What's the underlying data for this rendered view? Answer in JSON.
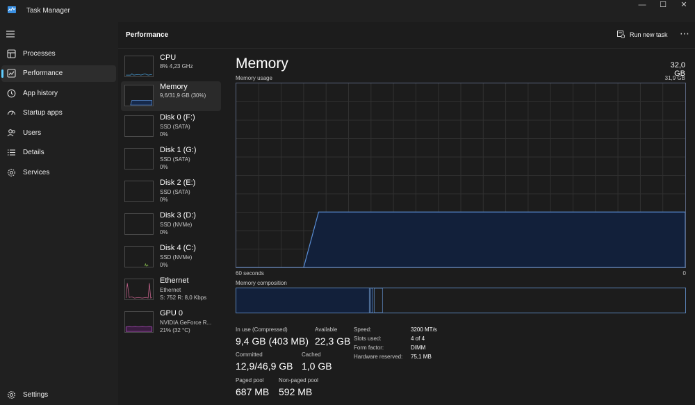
{
  "window": {
    "title": "Task Manager"
  },
  "sidebar": {
    "items": [
      {
        "label": "Processes"
      },
      {
        "label": "Performance"
      },
      {
        "label": "App history"
      },
      {
        "label": "Startup apps"
      },
      {
        "label": "Users"
      },
      {
        "label": "Details"
      },
      {
        "label": "Services"
      }
    ],
    "settings": "Settings"
  },
  "header": {
    "title": "Performance",
    "run_new_task": "Run new task"
  },
  "devices": [
    {
      "name": "CPU",
      "line1": "8% 4,23 GHz"
    },
    {
      "name": "Memory",
      "line1": "9,6/31,9 GB (30%)"
    },
    {
      "name": "Disk 0 (F:)",
      "line1": "SSD (SATA)",
      "line2": "0%"
    },
    {
      "name": "Disk 1 (G:)",
      "line1": "SSD (SATA)",
      "line2": "0%"
    },
    {
      "name": "Disk 2 (E:)",
      "line1": "SSD (SATA)",
      "line2": "0%"
    },
    {
      "name": "Disk 3 (D:)",
      "line1": "SSD (NVMe)",
      "line2": "0%"
    },
    {
      "name": "Disk 4 (C:)",
      "line1": "SSD (NVMe)",
      "line2": "0%"
    },
    {
      "name": "Ethernet",
      "line1": "Ethernet",
      "line2": "S: 752 R: 8,0 Kbps"
    },
    {
      "name": "GPU 0",
      "line1": "NVIDIA GeForce R...",
      "line2": "21% (32 °C)"
    }
  ],
  "memory": {
    "title": "Memory",
    "total": "32,0 GB",
    "usage_label": "Memory usage",
    "usage_max": "31,9 GB",
    "time_label": "60 seconds",
    "time_end": "0",
    "composition_label": "Memory composition",
    "stats": {
      "in_use_label": "In use (Compressed)",
      "in_use": "9,4 GB (403 MB)",
      "available_label": "Available",
      "available": "22,3 GB",
      "committed_label": "Committed",
      "committed": "12,9/46,9 GB",
      "cached_label": "Cached",
      "cached": "1,0 GB",
      "paged_label": "Paged pool",
      "paged": "687 MB",
      "nonpaged_label": "Non-paged pool",
      "nonpaged": "592 MB"
    },
    "specs": [
      {
        "k": "Speed:",
        "v": "3200 MT/s"
      },
      {
        "k": "Slots used:",
        "v": "4 of 4"
      },
      {
        "k": "Form factor:",
        "v": "DIMM"
      },
      {
        "k": "Hardware reserved:",
        "v": "75,1 MB"
      }
    ]
  },
  "chart_data": {
    "type": "area",
    "y_max_gb": 31.9,
    "x_seconds": [
      60,
      51,
      49,
      30,
      20,
      10,
      0
    ],
    "used_gb": [
      0,
      0,
      9.6,
      9.6,
      9.6,
      9.6,
      9.6
    ]
  },
  "colors": {
    "accent": "#60cdff",
    "memory_line": "#5a8ed6",
    "memory_fill": "#12203a"
  }
}
